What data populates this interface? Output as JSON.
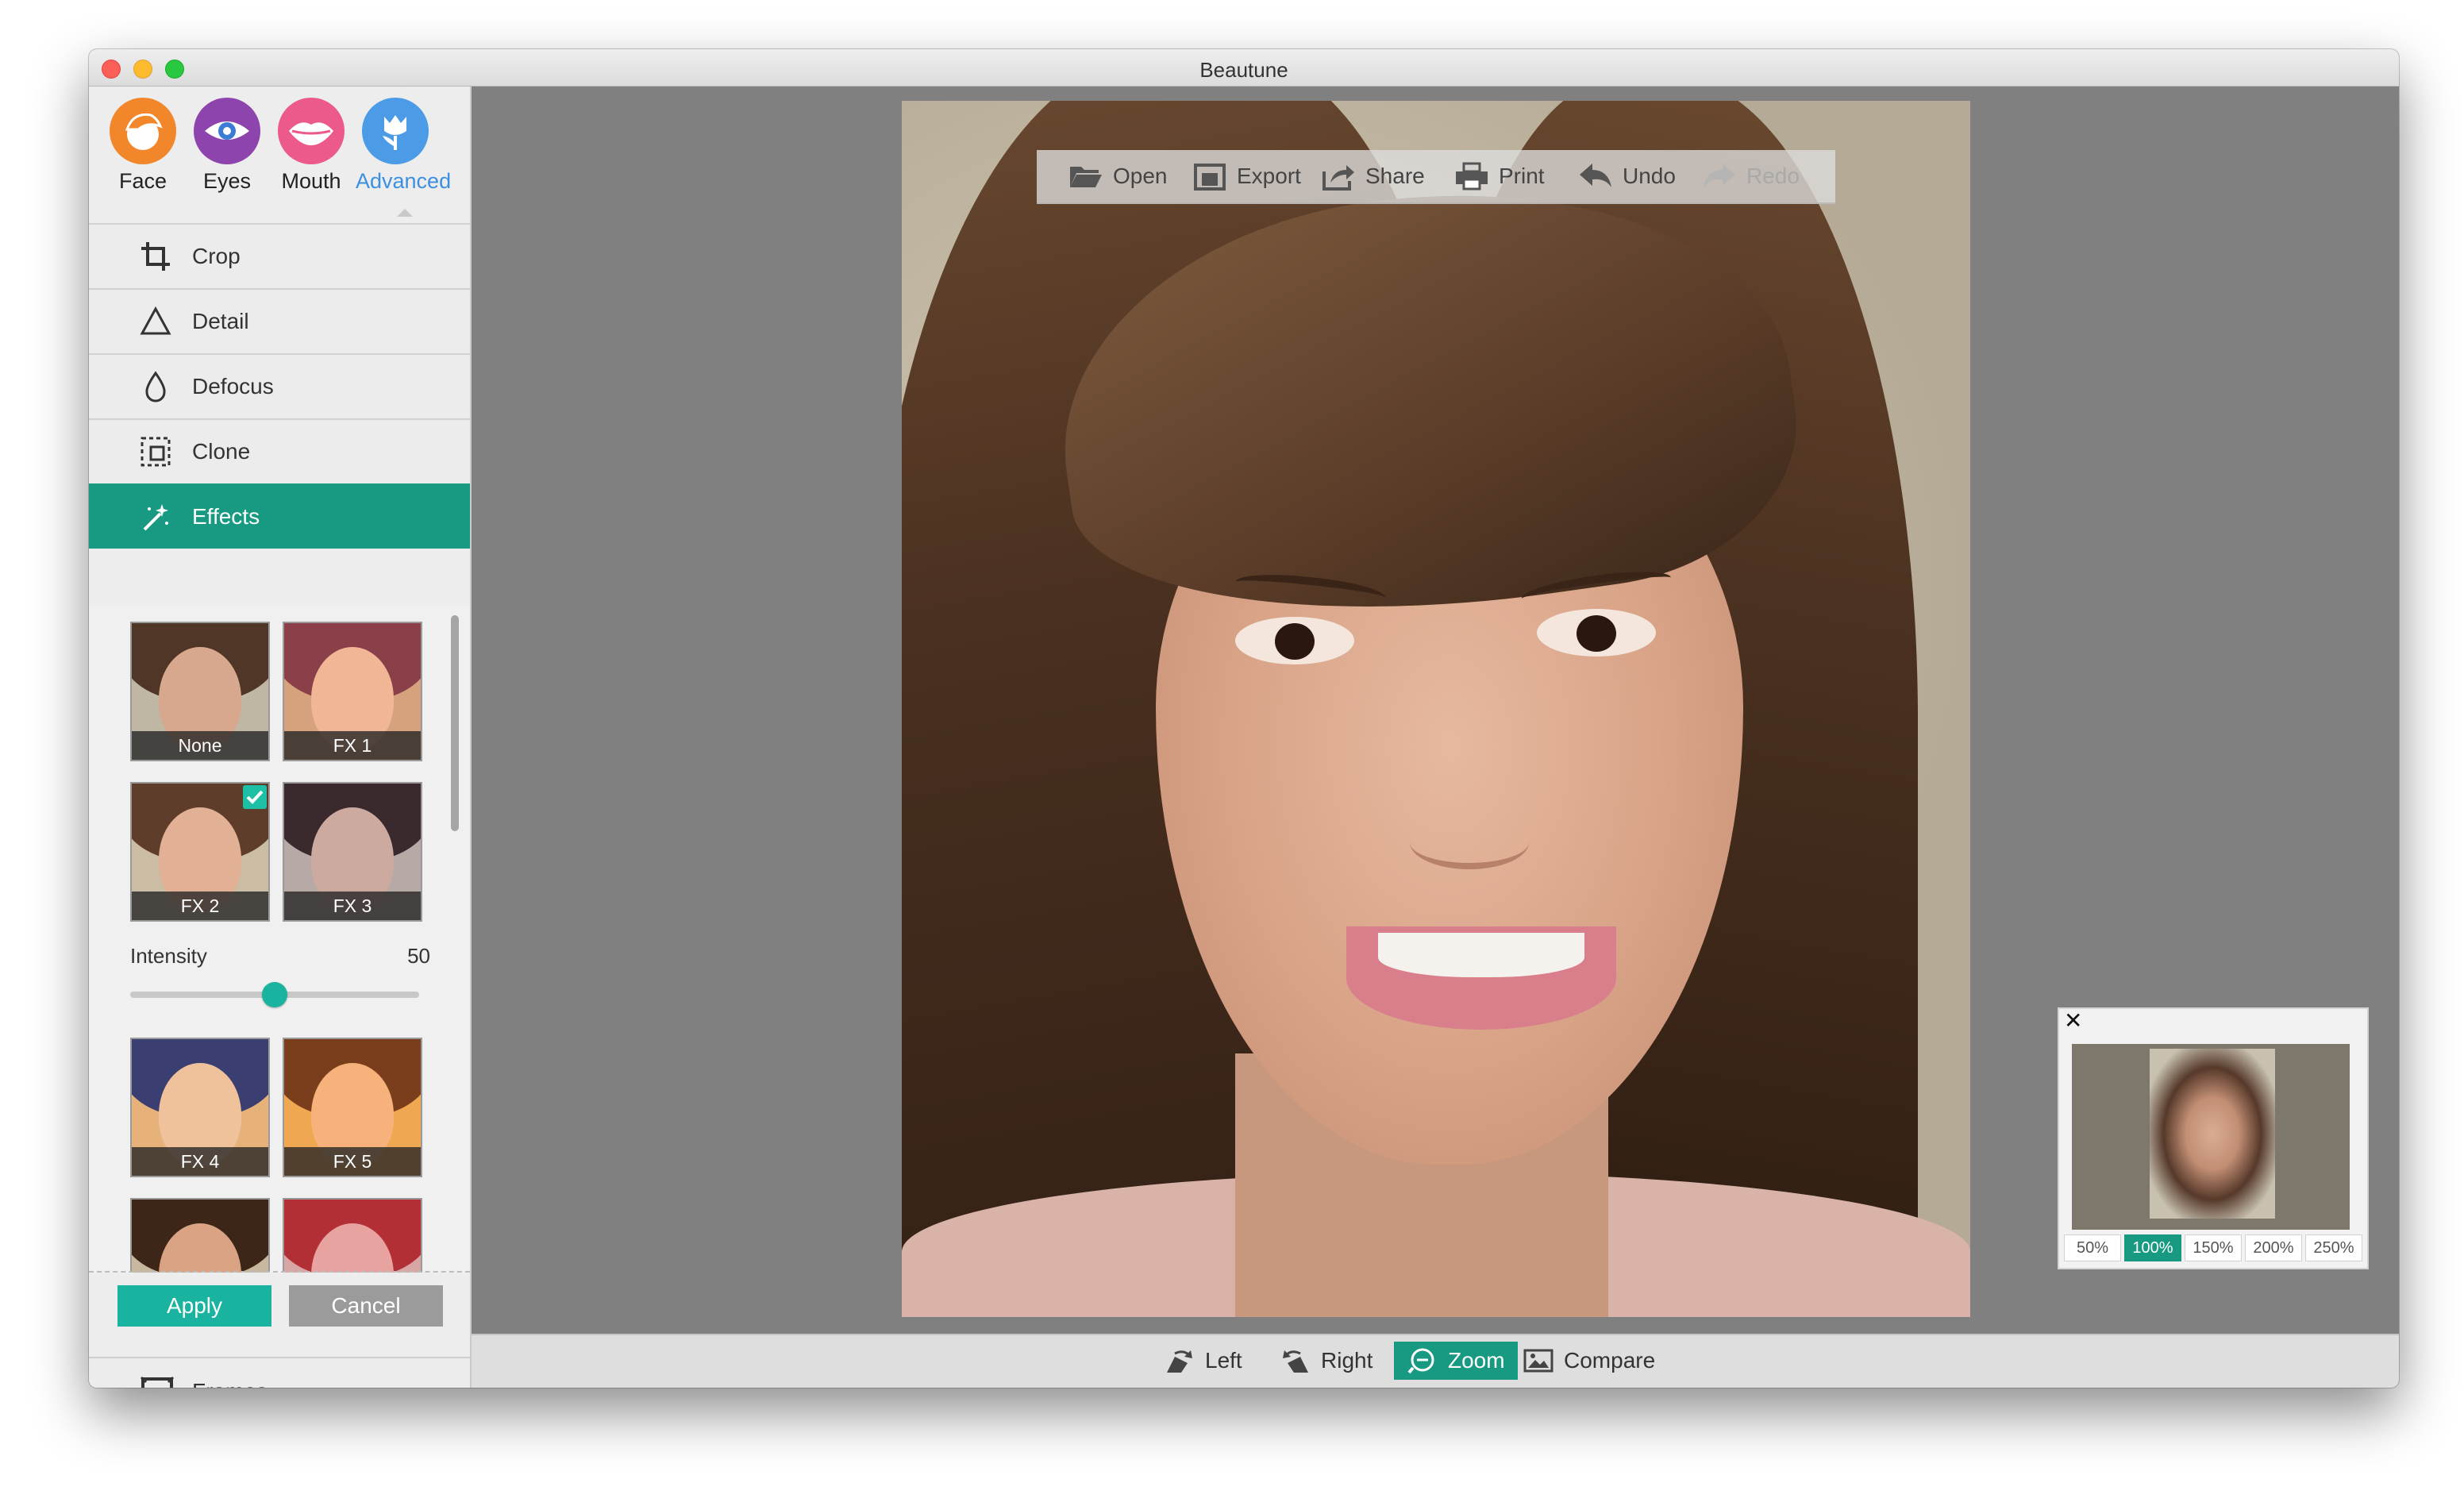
{
  "window": {
    "title": "Beautune"
  },
  "categories": [
    {
      "label": "Face",
      "color": "#f2862b",
      "icon": "face-icon"
    },
    {
      "label": "Eyes",
      "color": "#8e44ad",
      "icon": "eye-icon"
    },
    {
      "label": "Mouth",
      "color": "#ec5a8c",
      "icon": "lips-icon"
    },
    {
      "label": "Advanced",
      "color": "#4b9be6",
      "icon": "tulip-icon",
      "active": true
    }
  ],
  "tools": [
    {
      "label": "Crop",
      "icon": "crop-icon"
    },
    {
      "label": "Detail",
      "icon": "triangle-icon"
    },
    {
      "label": "Defocus",
      "icon": "drop-icon"
    },
    {
      "label": "Clone",
      "icon": "clone-icon"
    },
    {
      "label": "Effects",
      "icon": "magic-wand-icon",
      "active": true
    }
  ],
  "effects": [
    {
      "label": "None"
    },
    {
      "label": "FX 1"
    },
    {
      "label": "FX 2",
      "selected": true
    },
    {
      "label": "FX 3"
    },
    {
      "label": "FX 4"
    },
    {
      "label": "FX 5"
    }
  ],
  "intensity": {
    "label": "Intensity",
    "value": "50",
    "level": 0.5
  },
  "actions": {
    "apply": "Apply",
    "cancel": "Cancel"
  },
  "frames": {
    "label": "Frames",
    "icon": "frame-icon"
  },
  "toolbar": [
    {
      "label": "Open",
      "icon": "folder-open-icon"
    },
    {
      "label": "Export",
      "icon": "export-icon"
    },
    {
      "label": "Share",
      "icon": "share-icon"
    },
    {
      "label": "Print",
      "icon": "printer-icon"
    },
    {
      "label": "Undo",
      "icon": "undo-icon"
    },
    {
      "label": "Redo",
      "icon": "redo-icon",
      "disabled": true
    }
  ],
  "navigator": {
    "zoom_options": [
      "50%",
      "100%",
      "150%",
      "200%",
      "250%"
    ],
    "active_zoom": "100%"
  },
  "bottombar": [
    {
      "label": "Left",
      "icon": "rotate-left-icon"
    },
    {
      "label": "Right",
      "icon": "rotate-right-icon"
    },
    {
      "label": "Zoom",
      "icon": "zoom-icon",
      "active": true
    },
    {
      "label": "Compare",
      "icon": "compare-icon"
    }
  ]
}
